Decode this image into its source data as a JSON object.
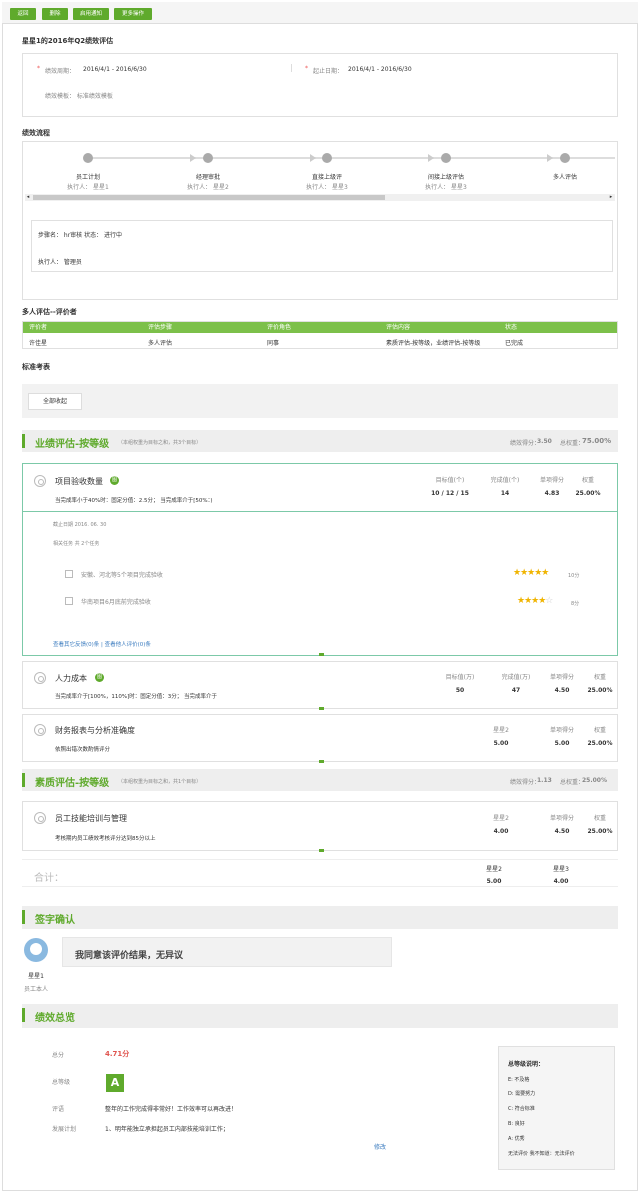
{
  "toolbar": {
    "b1": "返回",
    "b2": "删除",
    "b3": "启用通知",
    "b4": "更多操作"
  },
  "title": "星星1的2016年Q2绩效评估",
  "info": {
    "period_label": "绩效周期：",
    "period_value": "2016/4/1 - 2016/6/30",
    "end_label": "起止日期：",
    "end_value": "2016/4/1 - 2016/6/30",
    "template": "绩效模板：  标准绩效模板"
  },
  "process": {
    "title": "绩效流程",
    "steps": [
      {
        "name": "员工计划",
        "exec": "执行人：  星星1"
      },
      {
        "name": "经理审批",
        "exec": "执行人：  星星2"
      },
      {
        "name": "直接上级评",
        "exec": "执行人：  星星3"
      },
      {
        "name": "间接上级评估",
        "exec": "执行人：  星星3"
      },
      {
        "name": "多人评估",
        "exec": ""
      }
    ],
    "detail_step": "步骤名：  hr审核    状态：  进行中",
    "detail_exec": "执行人：  管理员"
  },
  "multi": {
    "title": "多人评估--评价者",
    "headers": [
      "评价者",
      "评估步骤",
      "评价角色",
      "评估内容",
      "状态"
    ],
    "row": [
      "许佳星",
      "多人评估",
      "同事",
      "素质评估-按等级，业绩评估-按等级",
      "已完成"
    ]
  },
  "standard": {
    "title": "标准考表",
    "collapse": "全部收起"
  },
  "perf_section": {
    "title": "业绩评估-按等级",
    "note": "（本组权重为目标之和，共3个目标）",
    "score_label": "绩效得分：",
    "score": "3.50",
    "weight_label": "总权重：",
    "weight": "75.00%"
  },
  "item1": {
    "name": "项目验收数量",
    "badge": "图",
    "desc": "当完成率小于40%时：固定分值：2.5分；   当完成率介于[50%：)",
    "h1": "目标值(个)",
    "h2": "完成值(个)",
    "h3": "单项得分",
    "h4": "权重",
    "v1": "10 / 12 / 15",
    "v2": "14",
    "v3": "4.83",
    "v4": "25.00%",
    "deadline": "截止日期  2016. 06. 30",
    "related": "相关任务  共 2个任务",
    "task1": "安徽、河北等5个项目完成验收",
    "task1_score": "10分",
    "task2": "华南项目6月底前完成验收",
    "task2_score": "8分",
    "links": "查看其它反馈(0)条 | 查看他人评价(0)条"
  },
  "item2": {
    "name": "人力成本",
    "badge": "图",
    "desc": "当完成率介于[100%，110%]时：固定分值：3分；   当完成率介于",
    "h1": "目标值(万)",
    "h2": "完成值(万)",
    "h3": "单项得分",
    "h4": "权重",
    "v1": "50",
    "v2": "47",
    "v3": "4.50",
    "v4": "25.00%"
  },
  "item3": {
    "name": "财务报表与分析准确度",
    "desc": "依照出错次数酌情评分",
    "h1": "星星2",
    "h2": "单项得分",
    "h3": "权重",
    "v1": "5.00",
    "v2": "5.00",
    "v3": "25.00%"
  },
  "quality_section": {
    "title": "素质评估-按等级",
    "note": "（本组权重为目标之和，共1个目标）",
    "score_label": "绩效得分：",
    "score": "1.13",
    "weight_label": "总权重：",
    "weight": "25.00%"
  },
  "item4": {
    "name": "员工技能培训与管理",
    "desc": "考核期内员工绩效考核评分达到85分以上",
    "h1": "星星2",
    "h2": "单项得分",
    "h3": "权重",
    "v1": "4.00",
    "v2": "4.50",
    "v3": "25.00%"
  },
  "total": {
    "label": "合计：",
    "h1": "星星2",
    "h2": "星星3",
    "v1": "5.00",
    "v2": "4.00"
  },
  "sign": {
    "title": "签字确认",
    "message": "我同意该评价结果，无异议",
    "user": "星星1",
    "role": "员工本人"
  },
  "overview": {
    "title": "绩效总览",
    "score_label": "总分",
    "score": "4.71分",
    "grade_label": "总等级",
    "grade": "A",
    "comment_label": "评语",
    "comment": "整年的工作完成得非常好！工作效率可以再改进！",
    "plan_label": "发展计划",
    "plan": "1、明年能独立承担起员工内部技能培训工作；",
    "edit": "修改"
  },
  "legend": {
    "title": "总等级说明：",
    "items": [
      "E: 不及格",
      "D: 需要努力",
      "C: 符合标准",
      "B: 良好",
      "A: 优秀",
      "无法评价  我不知道：无法评价"
    ]
  },
  "colors": {
    "accent": "#5faa2c"
  }
}
